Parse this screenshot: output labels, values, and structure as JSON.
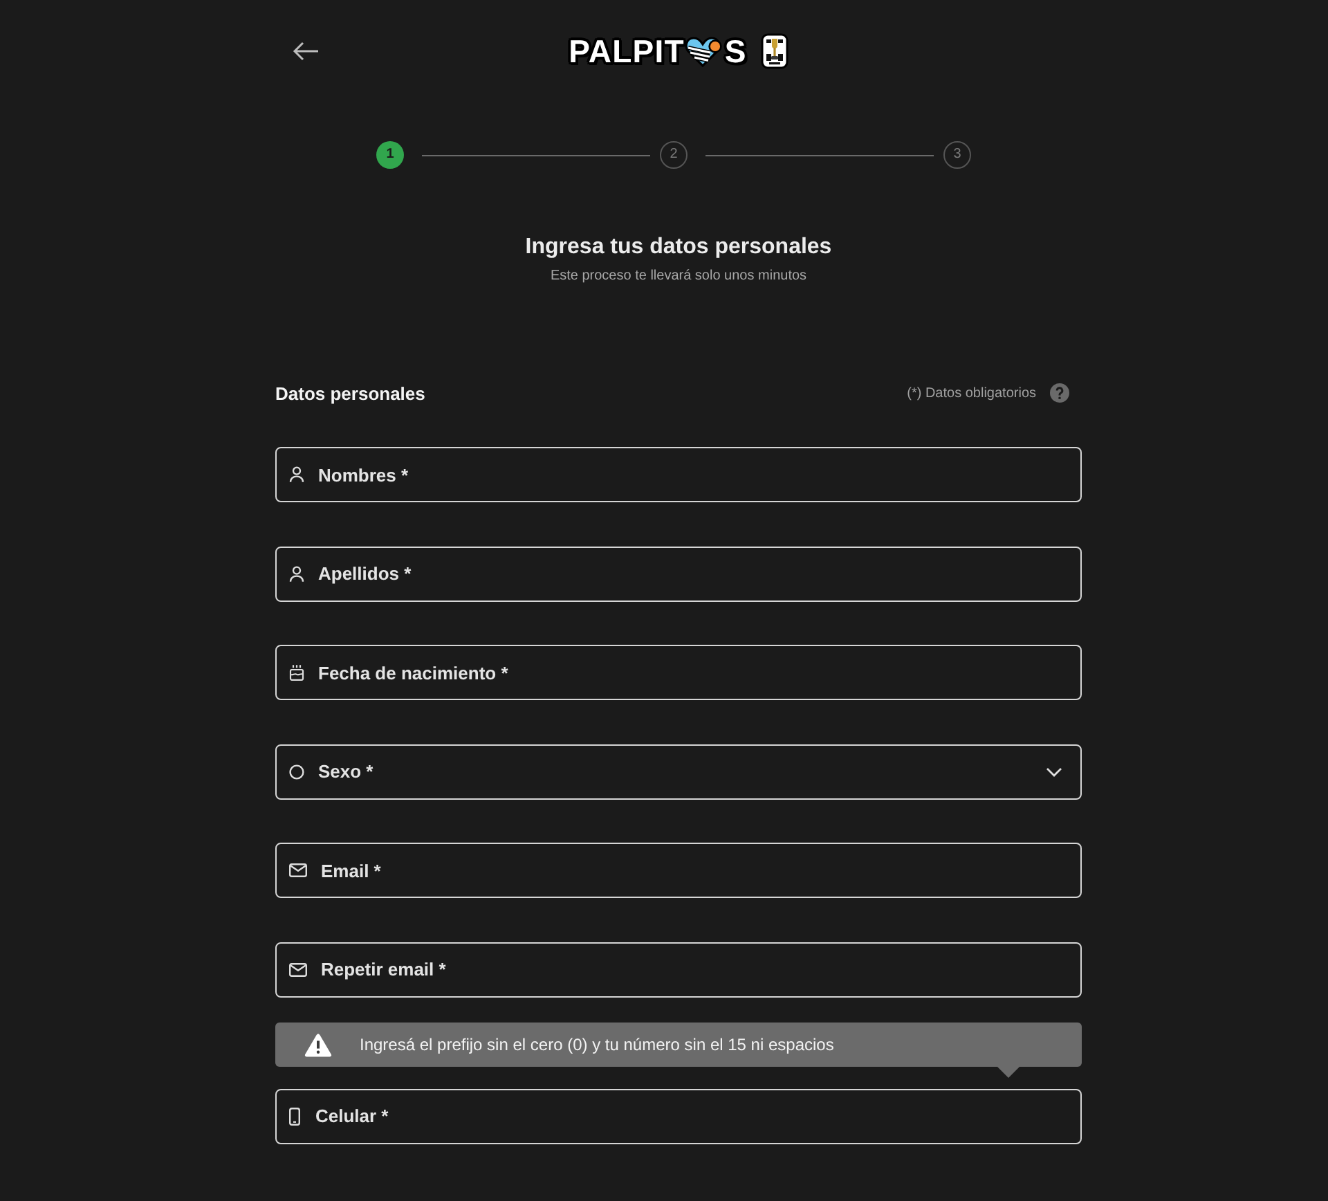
{
  "header": {
    "logo": {
      "text_before": "PALPIT",
      "text_after": "S"
    }
  },
  "stepper": {
    "steps": [
      {
        "number": "1",
        "selected": true
      },
      {
        "number": "2",
        "selected": false
      },
      {
        "number": "3",
        "selected": false
      }
    ]
  },
  "intro": {
    "title": "Ingresa tus datos personales",
    "subtitle": "Este proceso te llevará solo unos minutos"
  },
  "section": {
    "title": "Datos personales",
    "required_note": "(*) Datos obligatorios"
  },
  "fields": [
    {
      "kind": "text",
      "placeholder": "Nombres *"
    },
    {
      "kind": "text",
      "placeholder": "Apellidos *"
    },
    {
      "kind": "date",
      "placeholder": "Fecha de nacimiento *"
    },
    {
      "kind": "select",
      "placeholder": "Sexo *"
    },
    {
      "kind": "email",
      "placeholder": "Email *"
    },
    {
      "kind": "email",
      "placeholder": "Repetir email *"
    },
    {
      "kind": "phone",
      "placeholder": "Celular *",
      "hint": "Ingresá el prefijo sin el cero (0) y tu número sin el 15 ni espacios"
    }
  ]
}
